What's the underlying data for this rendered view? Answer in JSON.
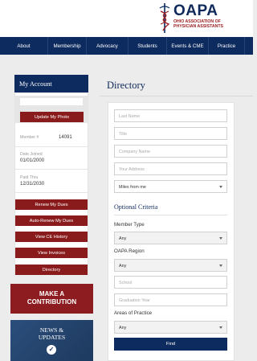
{
  "brand": {
    "name": "OAPA",
    "subtitle_line1": "Ohio Association of",
    "subtitle_line2": "Physician Assistants",
    "colors": {
      "navy": "#0d2b5e",
      "maroon": "#8a1b1c"
    }
  },
  "nav": {
    "items": [
      "About",
      "Membership",
      "Advocacy",
      "Students",
      "Events & CME",
      "Practice"
    ]
  },
  "sidebar": {
    "title": "My Account",
    "update_photo": "Update My Photo",
    "member_label": "Member #",
    "member_value": "14091",
    "date_joined_label": "Date Joined",
    "date_joined_value": "01/01/2000",
    "paid_thru_label": "Paid Thru",
    "paid_thru_value": "12/31/2030",
    "buttons": [
      "Renew My Dues",
      "Auto-Renew My Dues",
      "View CE History",
      "View Invoices",
      "Directory"
    ],
    "contribution_line1": "MAKE A",
    "contribution_line2": "CONTRIBUTION",
    "news_line1": "NEWS &",
    "news_line2": "UPDATES",
    "news_icon": "check-circle-icon"
  },
  "main": {
    "title": "Directory",
    "fields": {
      "last_name": "Last Name",
      "title": "Title",
      "company": "Company Name",
      "address": "Your Address",
      "distance": "Miles from me"
    },
    "optional_title": "Optional Criteria",
    "member_type_label": "Member Type",
    "member_type_value": "Any",
    "region_label": "OAPA Region",
    "region_value": "Any",
    "school_placeholder": "School",
    "grad_placeholder": "Graduation Year",
    "practice_label": "Areas of Practice",
    "practice_value": "Any",
    "find_label": "Find"
  }
}
